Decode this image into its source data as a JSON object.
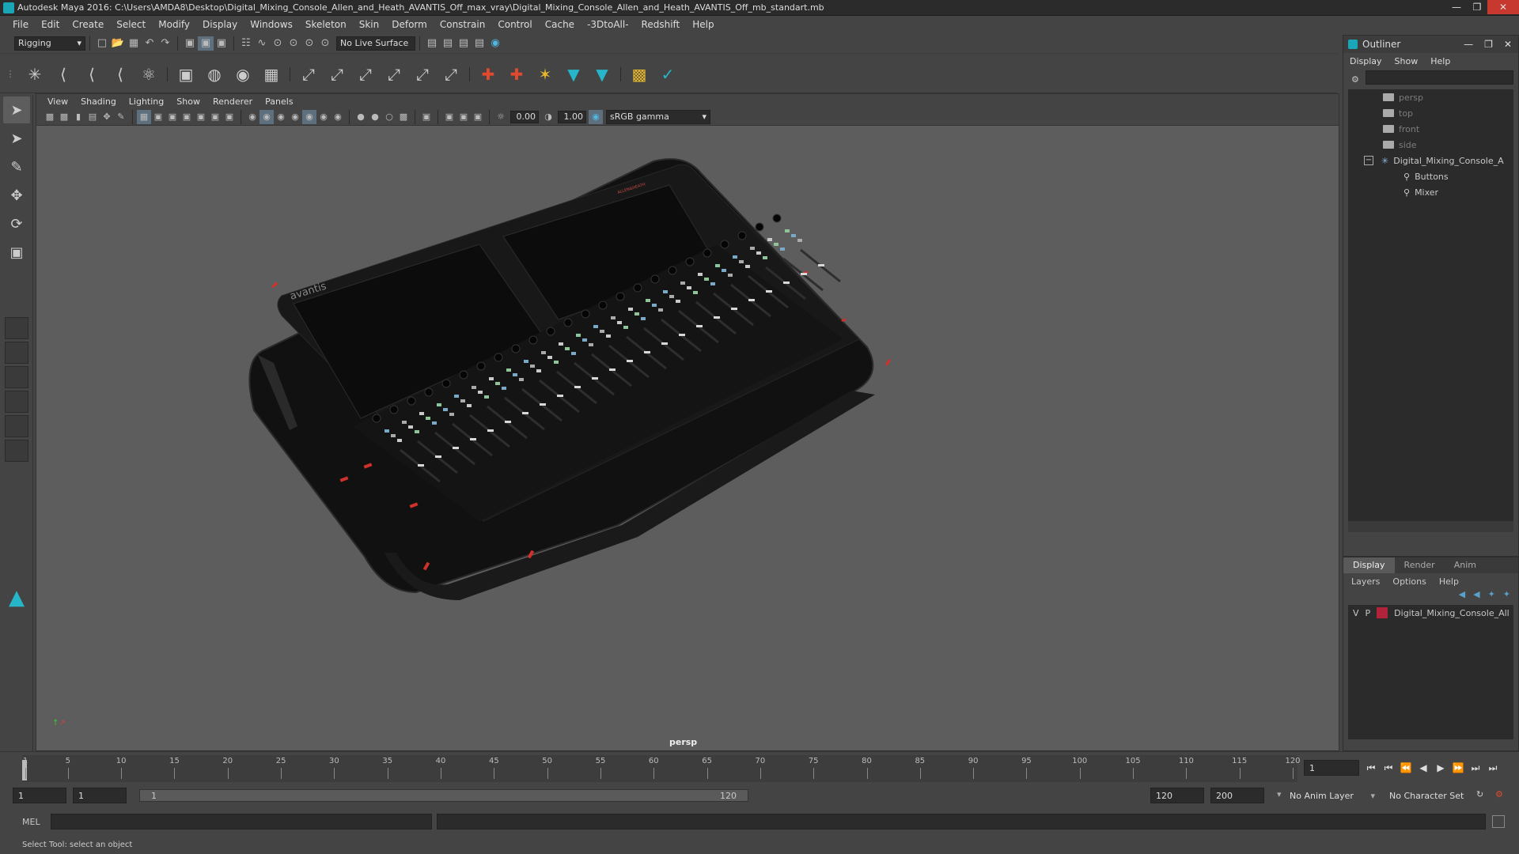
{
  "window": {
    "title": "Autodesk Maya 2016: C:\\Users\\AMDA8\\Desktop\\Digital_Mixing_Console_Allen_and_Heath_AVANTIS_Off_max_vray\\Digital_Mixing_Console_Allen_and_Heath_AVANTIS_Off_mb_standart.mb"
  },
  "menubar": [
    "File",
    "Edit",
    "Create",
    "Select",
    "Modify",
    "Display",
    "Windows",
    "Skeleton",
    "Skin",
    "Deform",
    "Constrain",
    "Control",
    "Cache",
    "-3DtoAll-",
    "Redshift",
    "Help"
  ],
  "statusline": {
    "menu_set": "Rigging",
    "live_surface": "No Live Surface"
  },
  "panel": {
    "menus": [
      "View",
      "Shading",
      "Lighting",
      "Show",
      "Renderer",
      "Panels"
    ],
    "exposure": "0.00",
    "gamma": "1.00",
    "color_space": "sRGB gamma",
    "camera_label": "persp"
  },
  "model": {
    "brand_label": "avantis",
    "logo_label": "ALLEN&HEATH"
  },
  "outliner": {
    "title": "Outliner",
    "menus": [
      "Display",
      "Show",
      "Help"
    ],
    "items": [
      {
        "label": "persp",
        "type": "camera"
      },
      {
        "label": "top",
        "type": "camera"
      },
      {
        "label": "front",
        "type": "camera"
      },
      {
        "label": "side",
        "type": "camera"
      },
      {
        "label": "Digital_Mixing_Console_A",
        "type": "group"
      },
      {
        "label": "Buttons",
        "type": "child"
      },
      {
        "label": "Mixer",
        "type": "child"
      }
    ]
  },
  "layers": {
    "tabs": [
      "Display",
      "Render",
      "Anim"
    ],
    "menus": [
      "Layers",
      "Options",
      "Help"
    ],
    "rows": [
      {
        "v": "V",
        "p": "P",
        "name": "Digital_Mixing_Console_All",
        "color": "#b0233a"
      }
    ]
  },
  "timeline": {
    "ticks": [
      "1",
      "5",
      "10",
      "15",
      "20",
      "25",
      "30",
      "35",
      "40",
      "45",
      "50",
      "55",
      "60",
      "65",
      "70",
      "75",
      "80",
      "85",
      "90",
      "95",
      "100",
      "105",
      "110",
      "115",
      "120"
    ],
    "current_frame": "1"
  },
  "range": {
    "start": "1",
    "playback_start": "1",
    "slider_start": "1",
    "slider_end": "120",
    "playback_end": "120",
    "end": "200",
    "anim_layer": "No Anim Layer",
    "character_set": "No Character Set"
  },
  "cmdline": {
    "lang": "MEL"
  },
  "helpline": {
    "text": "Select Tool: select an object"
  }
}
